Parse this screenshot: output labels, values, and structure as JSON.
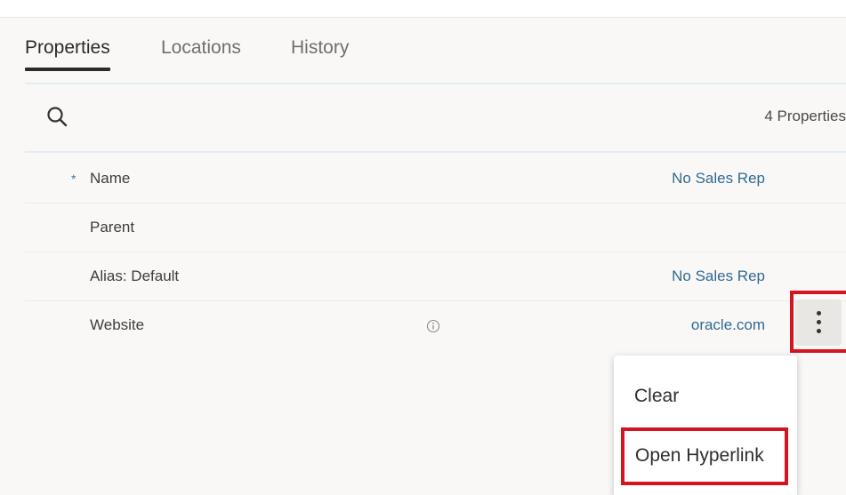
{
  "tabs": [
    {
      "label": "Properties",
      "active": true
    },
    {
      "label": "Locations",
      "active": false
    },
    {
      "label": "History",
      "active": false
    }
  ],
  "toolbar": {
    "search_icon": "search-icon",
    "count_text": "4 Properties"
  },
  "rows": [
    {
      "label": "Name",
      "required": true,
      "required_mark": "*",
      "value": "No Sales Rep"
    },
    {
      "label": "Parent",
      "required": false,
      "value": ""
    },
    {
      "label": "Alias: Default",
      "required": false,
      "value": "No Sales Rep"
    },
    {
      "label": "Website",
      "required": false,
      "info_icon": "info-icon",
      "value": "oracle.com"
    }
  ],
  "row_actions": {
    "icon": "kebab-menu-icon"
  },
  "context_menu": {
    "items": [
      {
        "label": "Clear"
      },
      {
        "label": "Open Hyperlink"
      }
    ]
  },
  "colors": {
    "link": "#316a94",
    "required_marker": "#3b78a8",
    "highlight": "#d4141f",
    "tab_active": "#2b2b2b"
  }
}
